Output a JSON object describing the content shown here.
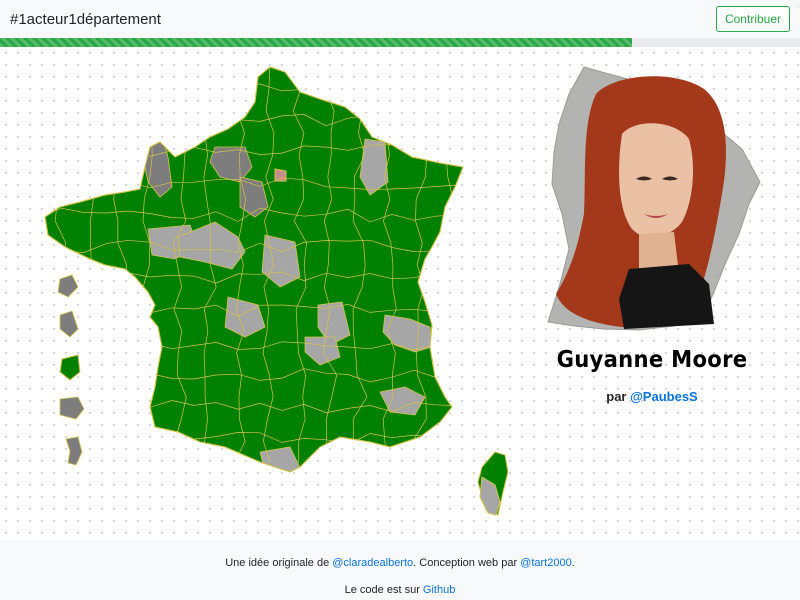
{
  "header": {
    "brand": "#1acteur1département",
    "contribute_label": "Contribuer",
    "progress": 0.79
  },
  "colors": {
    "green": "#008000",
    "light_gray": "#a6a6a6",
    "dark_gray": "#7d7d7d",
    "border": "#d4c44a",
    "accent": "#28a745",
    "link": "#0b74de"
  },
  "portrait": {
    "description_icon": "portrait-photo"
  },
  "actor": {
    "name": "Guyanne Moore",
    "by_prefix": "par",
    "by_handle": "@PaubesS"
  },
  "footer": {
    "line1_prefix": "Une idée originale de",
    "line1_author": "@claradealberto",
    "line1_middle": ". Conception web par",
    "line1_designer": "@tart2000",
    "line1_suffix": ".",
    "line2_prefix": "Le code est sur",
    "line2_link": "Github"
  }
}
